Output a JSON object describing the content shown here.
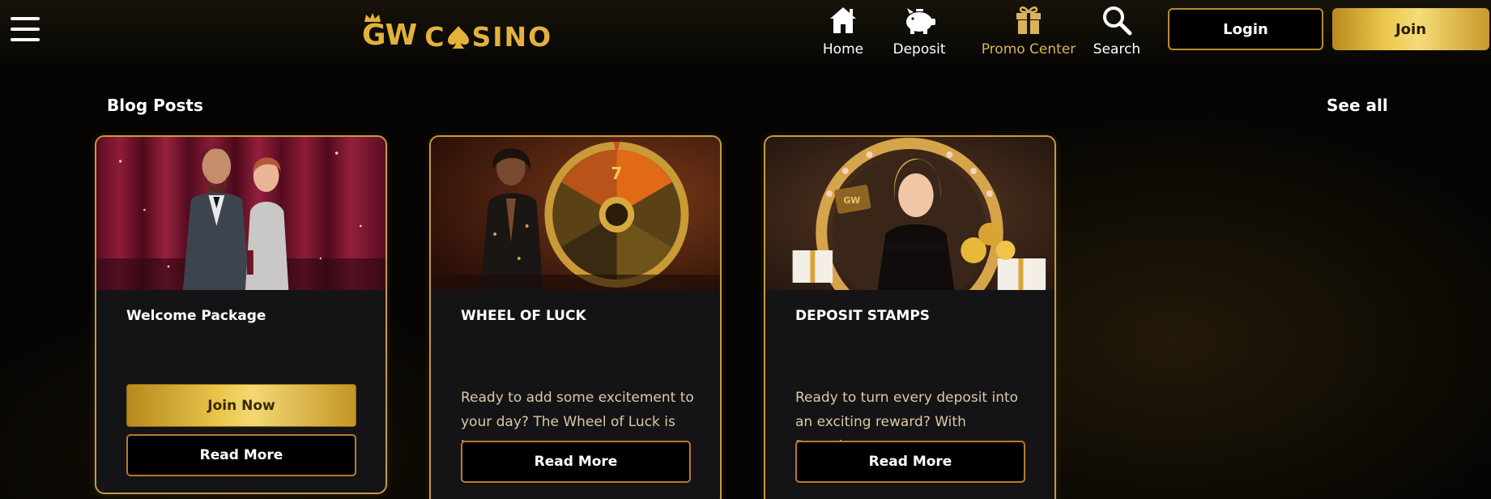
{
  "header": {
    "menu_icon": "hamburger-menu-icon",
    "logo": {
      "mark": "GW",
      "text_left": "C",
      "text_right": "SINO"
    },
    "nav": [
      {
        "label": "Home",
        "icon": "home-icon"
      },
      {
        "label": "Deposit",
        "icon": "piggy-bank-icon"
      },
      {
        "label": "Promo Center",
        "icon": "gift-icon",
        "active": true
      },
      {
        "label": "Search",
        "icon": "search-icon"
      }
    ],
    "login_label": "Login",
    "join_label": "Join"
  },
  "section": {
    "title": "Blog Posts",
    "see_all": "See all"
  },
  "cards": [
    {
      "title": "Welcome Package",
      "join_label": "Join Now",
      "read_label": "Read More"
    },
    {
      "title": "WHEEL OF LUCK",
      "description": "Ready to add some excitement to your day? The Wheel of Luck is he...",
      "read_label": "Read More"
    },
    {
      "title": "DEPOSIT STAMPS",
      "description": "Ready to turn every deposit into an exciting reward? With Deposit...",
      "read_label": "Read More"
    }
  ],
  "colors": {
    "gold": "#e2b23b",
    "gold_light": "#f3d873",
    "active_nav": "#d9b25a",
    "card_border": "#c79a3e",
    "card_bg": "#141416"
  }
}
